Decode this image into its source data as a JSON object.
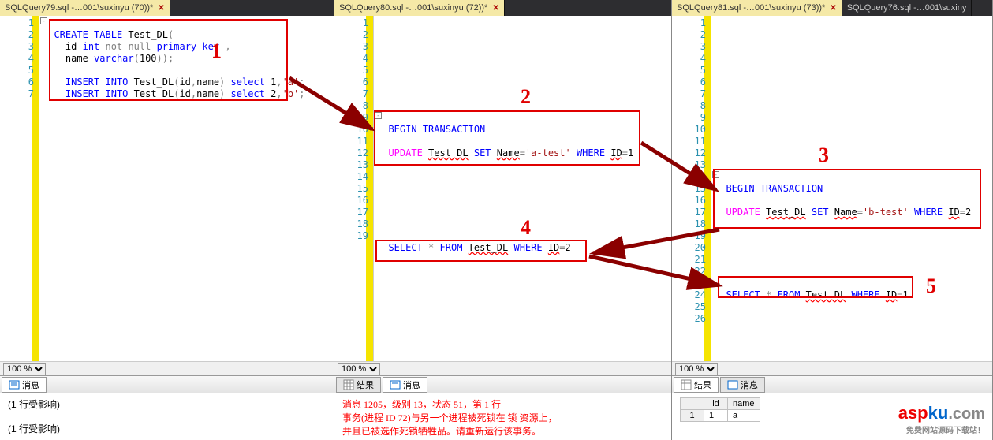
{
  "pane1": {
    "tab": "SQLQuery79.sql -…001\\suxinyu (70))*",
    "zoom": "100 %",
    "resulttab": "消息",
    "msg1": "(1 行受影响)",
    "msg2": "(1 行受影响)",
    "code": {
      "l1a": "CREATE",
      "l1b": "TABLE",
      "l1c": "Test_DL",
      "l2a": "id",
      "l2b": "int",
      "l2c": "not",
      "l2d": "null",
      "l2e": "primary",
      "l2f": "key",
      "l3a": "name",
      "l3b": "varchar",
      "l3c": "100",
      "l5a": "INSERT",
      "l5b": "INTO",
      "l5c": "Test_DL",
      "l5d": "id",
      "l5e": "name",
      "l5f": "select",
      "l5g": "1",
      "l5h": "'a'",
      "l6a": "INSERT",
      "l6b": "INTO",
      "l6c": "Test_DL",
      "l6d": "id",
      "l6e": "name",
      "l6f": "select",
      "l6g": "2",
      "l6h": "'b'"
    }
  },
  "pane2": {
    "tab": "SQLQuery80.sql -…001\\suxinyu (72))*",
    "zoom": "100 %",
    "resulttabs": [
      "结果",
      "消息"
    ],
    "err1": "消息 1205，级别 13，状态 51，第 1 行",
    "err2": "事务(进程 ID 72)与另一个进程被死锁在 锁 资源上，",
    "err3": "并且已被选作死锁牺牲品。请重新运行该事务。",
    "code": {
      "l9a": "BEGIN",
      "l9b": "TRANSACTION",
      "l11a": "UPDATE",
      "l11b": "Test_DL",
      "l11c": "SET",
      "l11d": "Name",
      "l11e": "'a-test'",
      "l11f": "WHERE",
      "l11g": "ID",
      "l11h": "1",
      "l19a": "SELECT",
      "l19b": "*",
      "l19c": "FROM",
      "l19d": "Test_DL",
      "l19e": "WHERE",
      "l19f": "ID",
      "l19g": "2"
    }
  },
  "pane3": {
    "tab1": "SQLQuery81.sql -…001\\suxinyu (73))*",
    "tab2": "SQLQuery76.sql -…001\\suxiny",
    "zoom": "100 %",
    "resulttabs": [
      "结果",
      "消息"
    ],
    "grid": {
      "h1": "id",
      "h2": "name",
      "r1": "1",
      "c1": "1",
      "c2": "a"
    },
    "code": {
      "l14a": "BEGIN",
      "l14b": "TRANSACTION",
      "l16a": "UPDATE",
      "l16b": "Test_DL",
      "l16c": "SET",
      "l16d": "Name",
      "l16e": "'b-test'",
      "l16f": "WHERE",
      "l16g": "ID",
      "l16h": "2",
      "l23a": "SELECT",
      "l23b": "*",
      "l23c": "FROM",
      "l23d": "Test_DL",
      "l23e": "WHERE",
      "l23f": "ID",
      "l23g": "1"
    }
  },
  "annotations": {
    "n1": "1",
    "n2": "2",
    "n3": "3",
    "n4": "4",
    "n5": "5"
  },
  "logo": {
    "asp": "asp",
    "ku": "ku",
    "com": ".com",
    "sub": "免费网站源码下载站！"
  }
}
